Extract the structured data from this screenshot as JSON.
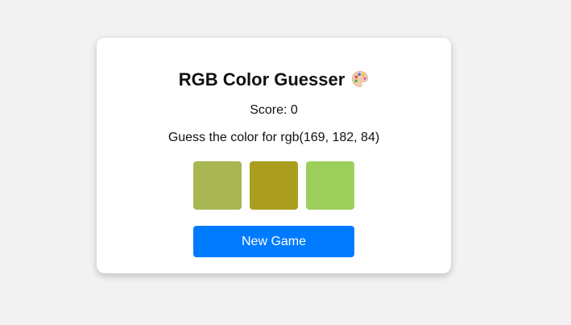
{
  "game": {
    "title": "RGB Color Guesser",
    "title_icon": "palette-icon",
    "score_text": "Score: 0",
    "prompt_text": "Guess the color for rgb(169, 182, 84)",
    "options": [
      {
        "color": "#a9b654"
      },
      {
        "color": "#ab9e1f"
      },
      {
        "color": "#9ccf5c"
      }
    ],
    "new_game_label": "New Game",
    "button_color": "#007bff"
  }
}
